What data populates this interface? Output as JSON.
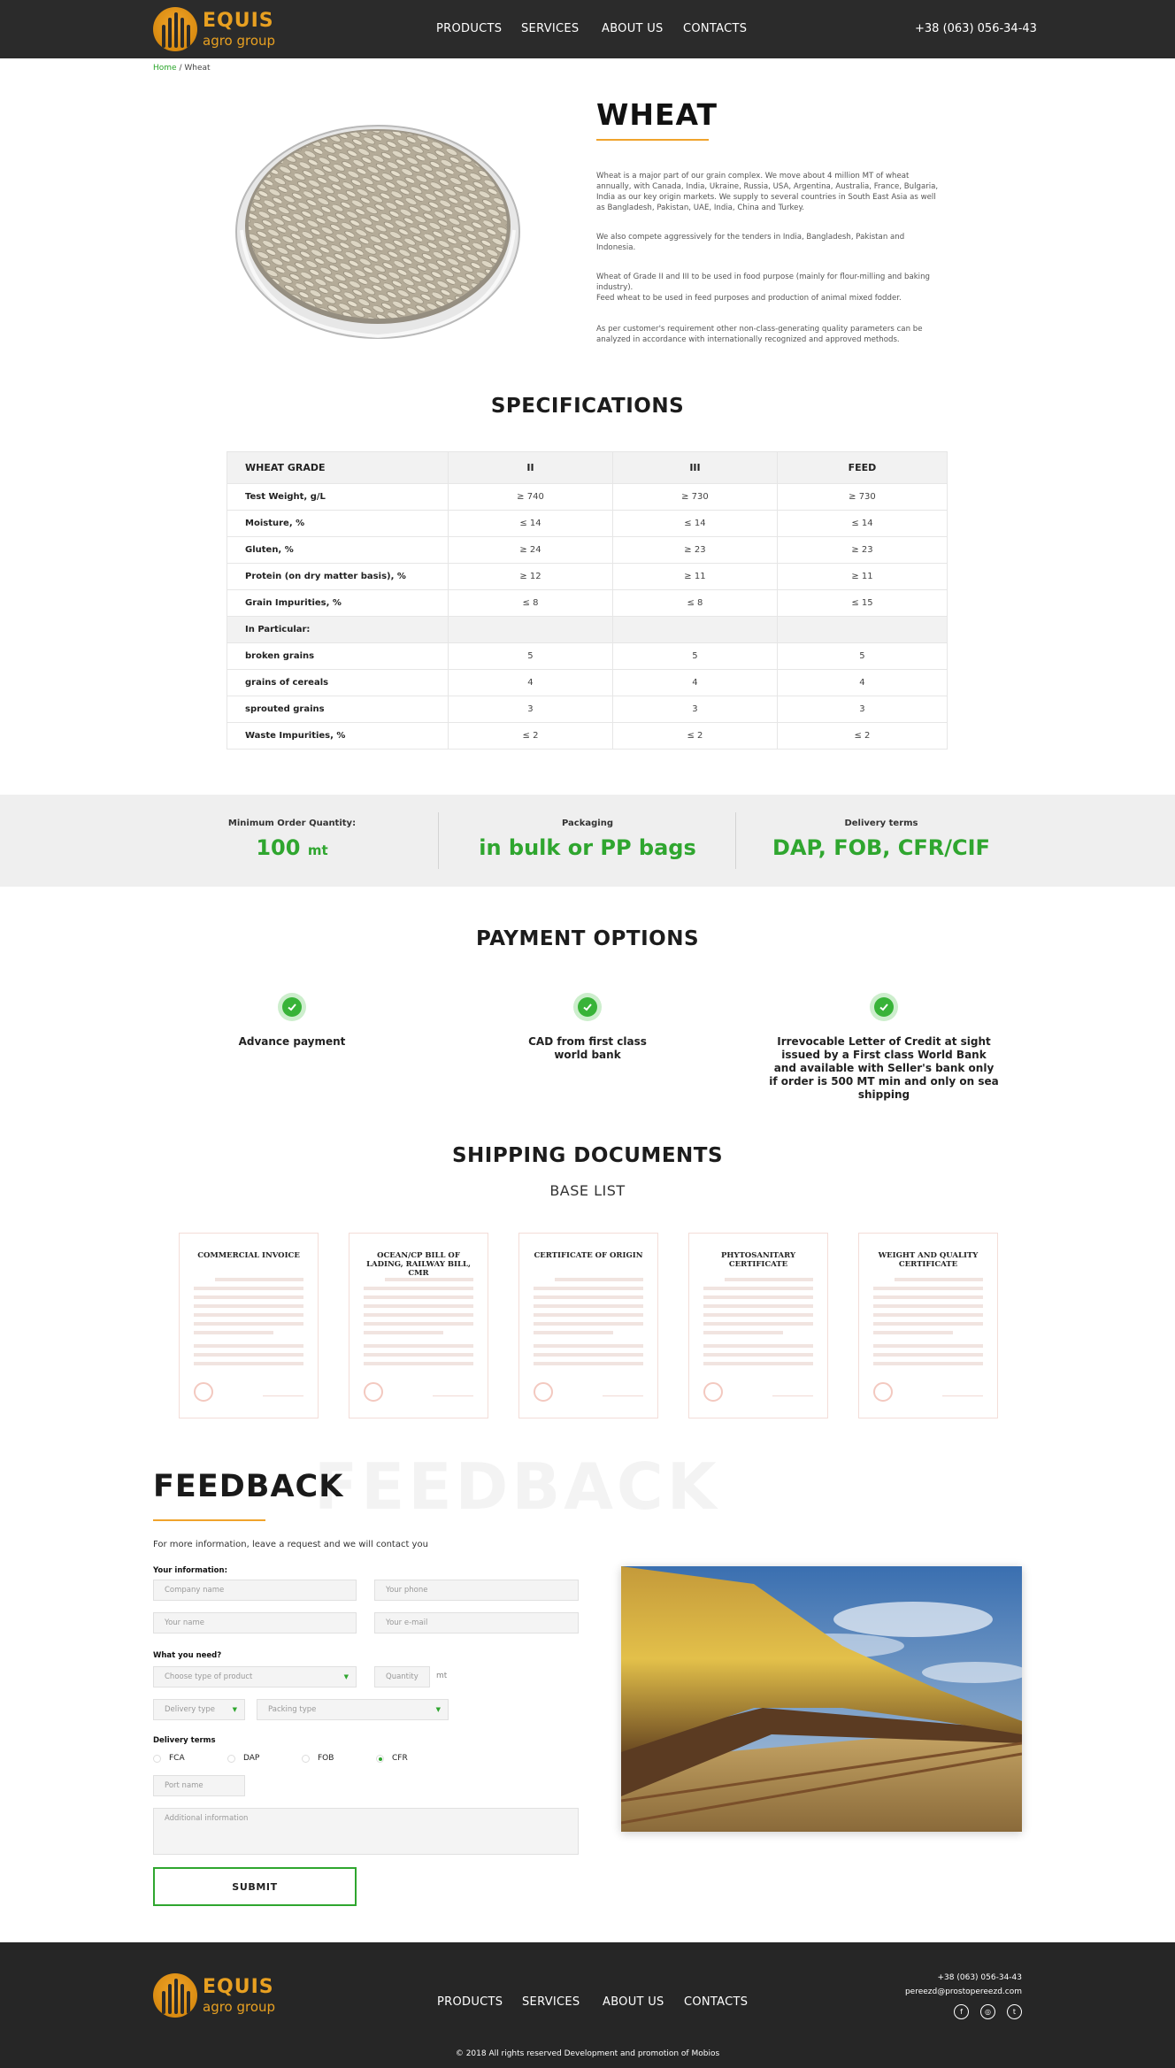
{
  "header": {
    "logo_name": "EQUIS",
    "logo_tagline": "agro group",
    "nav": [
      "PRODUCTS",
      "SERVICES",
      "ABOUT US",
      "CONTACTS"
    ],
    "phone": "+38 (063) 056-34-43"
  },
  "breadcrumb": {
    "home": "Home",
    "sep": " / ",
    "current": "Wheat"
  },
  "product": {
    "title": "WHEAT",
    "paragraphs": [
      "Wheat is a major part of our grain complex. We move about 4 million MT of wheat annually, with Canada, India, Ukraine, Russia, USA, Argentina, Australia, France, Bulgaria, India as our key origin markets. We supply to several countries in South East Asia as well as Bangladesh, Pakistan, UAE, India, China and Turkey.",
      "We also compete aggressively for the tenders in India, Bangladesh, Pakistan and Indonesia.",
      "Wheat of Grade II and III to be used in food purpose (mainly for flour-milling and baking industry).\nFeed wheat to be used in feed purposes and production of animal mixed fodder.",
      "As per customer's requirement other non-class-generating quality parameters can be analyzed in accordance with internationally recognized and approved methods."
    ]
  },
  "specifications": {
    "title": "SPECIFICATIONS",
    "header": [
      "WHEAT GRADE",
      "II",
      "III",
      "FEED"
    ],
    "rows": [
      [
        "Test Weight, g/L",
        "≥ 740",
        "≥ 730",
        "≥ 730"
      ],
      [
        "Moisture, %",
        "≤ 14",
        "≤ 14",
        "≤ 14"
      ],
      [
        "Gluten, %",
        "≥ 24",
        "≥ 23",
        "≥ 23"
      ],
      [
        "Protein (on dry matter basis), %",
        "≥ 12",
        "≥ 11",
        "≥ 11"
      ],
      [
        "Grain Impurities, %",
        "≤ 8",
        "≤ 8",
        "≤ 15"
      ]
    ],
    "subheader": "In Particular:",
    "rows2": [
      [
        "broken grains",
        "5",
        "5",
        "5"
      ],
      [
        "grains of cereals",
        "4",
        "4",
        "4"
      ],
      [
        "sprouted grains",
        "3",
        "3",
        "3"
      ],
      [
        "Waste Impurities, %",
        "≤ 2",
        "≤ 2",
        "≤ 2"
      ]
    ]
  },
  "order_info": {
    "min_label": "Minimum Order Quantity:",
    "min_value": "100",
    "min_unit": "mt",
    "pack_label": "Packaging",
    "pack_value": "in bulk or PP bags",
    "delivery_label": "Delivery terms",
    "delivery_value": "DAP, FOB, CFR/CIF"
  },
  "payment": {
    "title": "PAYMENT OPTIONS",
    "options": [
      "Advance payment",
      "CAD from first class world bank",
      "Irrevocable Letter of Credit at sight issued by a First class World Bank and available with Seller's bank only if order is 500 MT min and only on sea shipping"
    ]
  },
  "shipping": {
    "title": "SHIPPING DOCUMENTS",
    "subtitle": "BASE LIST",
    "docs": [
      "COMMERCIAL INVOICE",
      "OCEAN/CP BILL OF LADING, RAILWAY BILL, CMR",
      "CERTIFICATE OF ORIGIN",
      "PHYTOSANITARY CERTIFICATE",
      "WEIGHT AND QUALITY CERTIFICATE"
    ]
  },
  "feedback": {
    "title": "FEEDBACK",
    "bg_title": "FEEDBACK",
    "intro": "For more information, leave a request and we will contact you",
    "your_info_label": "Your information:",
    "company_placeholder": "Company name",
    "phone_placeholder": "Your phone",
    "name_placeholder": "Your name",
    "email_placeholder": "Your e-mail",
    "need_label": "What you need?",
    "product_select": "Choose type of product",
    "quantity_placeholder": "Quantity",
    "quantity_unit": "mt",
    "delivery_type_select": "Delivery type",
    "packing_type_select": "Packing type",
    "terms_label": "Delivery terms",
    "terms": [
      "FCA",
      "DAP",
      "FOB",
      "CFR"
    ],
    "selected_term": "CFR",
    "port_placeholder": "Port name",
    "additional_placeholder": "Additional information",
    "submit": "SUBMIT"
  },
  "footer": {
    "nav": [
      "PRODUCTS",
      "SERVICES",
      "ABOUT US",
      "CONTACTS"
    ],
    "phone": "+38 (063) 056-34-43",
    "email": "pereezd@prostopereezd.com",
    "social": [
      "facebook-icon",
      "instagram-icon",
      "twitter-icon"
    ],
    "copyright": "© 2018 All rights reserved Development and promotion of Mobios"
  },
  "colors": {
    "accent": "#2fa62f",
    "brand": "#e8a021",
    "dark": "#2b2b2b"
  }
}
